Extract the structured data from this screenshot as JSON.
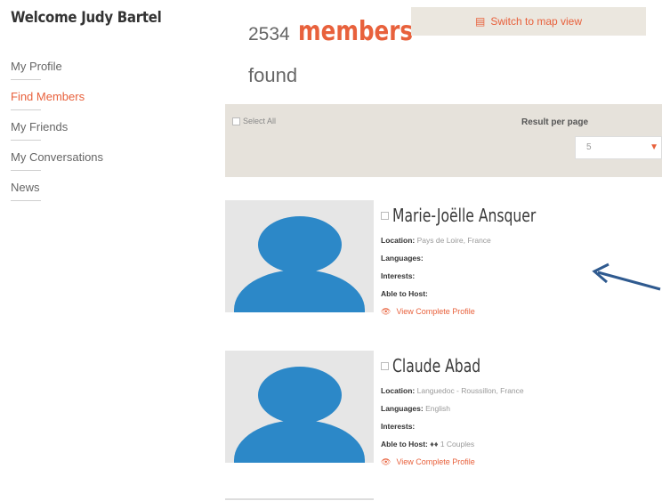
{
  "sidebar": {
    "welcome": "Welcome Judy Bartel",
    "items": [
      {
        "label": "My Profile",
        "active": false
      },
      {
        "label": "Find Members",
        "active": true
      },
      {
        "label": "My Friends",
        "active": false
      },
      {
        "label": "My Conversations",
        "active": false
      },
      {
        "label": "News",
        "active": false
      }
    ]
  },
  "header": {
    "count": "2534",
    "members_word": "members",
    "found_word": "found",
    "map_button_icon": "map-icon",
    "map_button_label": "Switch to map view"
  },
  "filters": {
    "select_all_label": "Select All",
    "result_per_page_label": "Result per page",
    "result_per_page_value": "5"
  },
  "members": [
    {
      "name": "Marie-Joëlle Ansquer",
      "location_label": "Location:",
      "location": "Pays de Loire, France",
      "languages_label": "Languages:",
      "languages": "",
      "interests_label": "Interests:",
      "interests": "",
      "host_label": "Able to Host:",
      "host_value": "",
      "view_link": "View Complete Profile"
    },
    {
      "name": "Claude Abad",
      "location_label": "Location:",
      "location": "Languedoc - Roussillon, France",
      "languages_label": "Languages:",
      "languages": "English",
      "interests_label": "Interests:",
      "interests": "",
      "host_label": "Able to Host:",
      "host_value": "1 Couples",
      "view_link": "View Complete Profile"
    }
  ],
  "colors": {
    "accent": "#e8613c",
    "avatar_blue": "#2c88c8",
    "filter_bg": "#e6e2db",
    "arrow": "#2f5a8f"
  }
}
